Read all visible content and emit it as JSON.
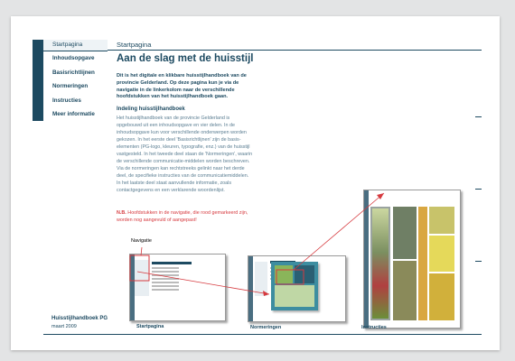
{
  "nav": {
    "start": "Startpagina",
    "items": [
      "Inhoudsopgave",
      "Basisrichtlijnen",
      "Normeringen",
      "Instructies",
      "Meer informatie"
    ]
  },
  "footer": {
    "title": "Huisstijlhandboek PG",
    "date": "maart 2009"
  },
  "header": {
    "breadcrumb": "Startpagina",
    "title": "Aan de slag met de huisstijl"
  },
  "intro": "Dit is het digitale en klikbare huisstijlhandboek van de provincie Gelderland. Op deze pagina kun je via de navigatie in de linkerkolom naar de verschillende hoofdstukken van het huisstijlhandboek gaan.",
  "section": {
    "heading": "Indeling huisstijlhandboek",
    "body": "Het huisstijlhandboek van de provincie Gelderland is opgebouwd uit een inhoudsopgave en vier delen. In de inhoudsopgave kun voor verschillende onderwerpen worden gekozen. In het eerste deel 'Basisrichtlijnen' zijn de basis-elementen (PG-logo, kleuren, typografie, enz.) van de huisstijl vastgesteld. In het tweede deel staan de 'Normeringen', waarin de verschillende communicatie-middelen worden beschreven. Via de normeringen kan rechtstreeks gelinkt naar het derde deel, de specifieke instructies van de communicatiemiddelen. In het laatste deel staat aanvullende informatie, zoals contactgegevens en een verklarende woordenlijst."
  },
  "note": {
    "prefix": "N.B.",
    "text": " Hoofdstukken in de navigatie, die rood gemarkeerd zijn, worden nog aangevuld of aangepast!"
  },
  "diagram": {
    "callout": "Navigatie",
    "captions": [
      "Startpagina",
      "Normeringen",
      "Instructies"
    ]
  },
  "colors": {
    "brand": "#1d4a61",
    "note": "#d63a3f",
    "arrow": "#d63a3f"
  }
}
